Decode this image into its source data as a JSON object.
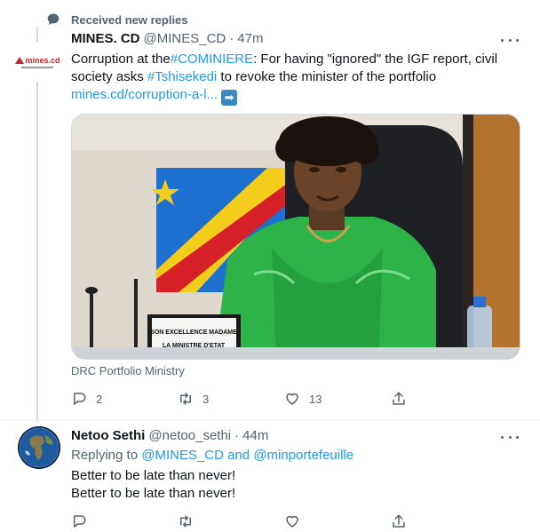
{
  "notice": {
    "label": "Received new replies",
    "icon": "chat-bubble-icon"
  },
  "tweet1": {
    "name": "MINES. CD",
    "handle": "@MINES_CD",
    "time": "47m",
    "avatar_text": "mines.cd",
    "text_before": "Corruption at the",
    "hashtag1": "#COMINIERE",
    "text_mid": ": For having \"ignored\" the IGF report, civil society asks ",
    "hashtag2": "#Tshisekedi",
    "text_after": " to revoke the minister of the portfolio",
    "link": "mines.cd/corruption-a-l...",
    "arrow": "➡",
    "media_placard_line1": "SON EXCELLENCE MADAME",
    "media_placard_line2": "LA MINISTRE D'ETAT",
    "caption": "DRC Portfolio Ministry",
    "reply_count": "2",
    "retweet_count": "3",
    "like_count": "13"
  },
  "tweet2": {
    "name": "Netoo Sethi",
    "handle": "@netoo_sethi",
    "time": "44m",
    "replying_prefix": "Replying to ",
    "replying_to": "@MINES_CD and @minportefeuille",
    "line1": "Better to be late than never!",
    "line2": "Better to be late than never!"
  },
  "icons": {
    "reply": "reply-icon",
    "retweet": "retweet-icon",
    "like": "heart-icon",
    "share": "share-icon",
    "more": "more-options-icon"
  },
  "colors": {
    "accent": "#1d9bf0",
    "muted": "#536471",
    "text": "#0f1419"
  }
}
